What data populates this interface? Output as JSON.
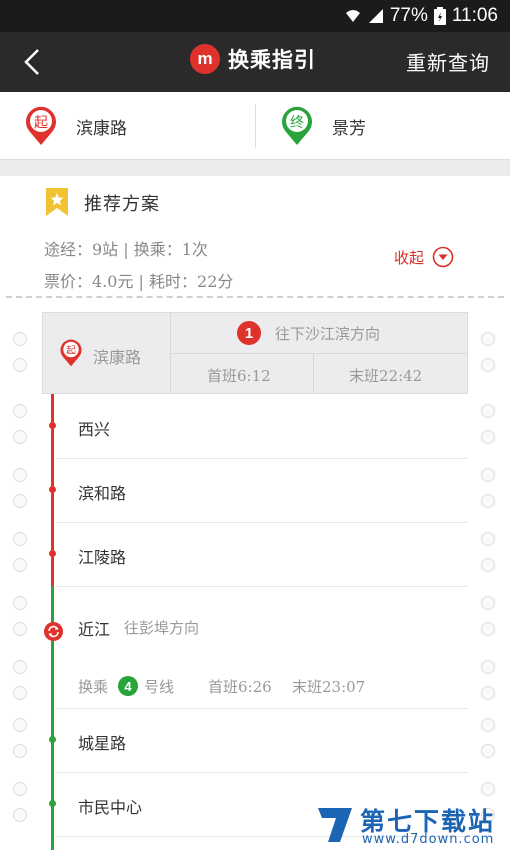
{
  "status_bar": {
    "battery": "77%",
    "time": "11:06"
  },
  "header": {
    "title": "换乘指引",
    "logo_letter": "m",
    "requery_label": "重新查询"
  },
  "route": {
    "origin_badge": "起",
    "origin": "滨康路",
    "destination_badge": "终",
    "destination": "景芳"
  },
  "plan": {
    "title": "推荐方案",
    "summary_line1": "途经：9站 | 换乘：1次",
    "summary_line2": "票价：4.0元 | 耗时：22分",
    "collapse_label": "收起"
  },
  "segment1": {
    "start_badge": "起",
    "start_station": "滨康路",
    "line_number": "1",
    "direction": "往下沙江滨方向",
    "first_train": "首班6:12",
    "last_train": "末班22:42"
  },
  "stations": [
    {
      "name": "西兴"
    },
    {
      "name": "滨和路"
    },
    {
      "name": "江陵路"
    },
    {
      "name": "近江",
      "direction": "往彭埠方向"
    },
    {
      "name": "城星路"
    },
    {
      "name": "市民中心"
    }
  ],
  "transfer": {
    "prefix": "换乘",
    "line_number": "4",
    "suffix": "号线",
    "first_train": "首班6:26",
    "last_train": "末班23:07"
  },
  "watermark": {
    "title": "第七下载站",
    "url": "www.d7down.com"
  },
  "colors": {
    "line1": "#e0322c",
    "line4": "#2aa33a",
    "accent": "#d9302a",
    "appbar": "#2a2a2a"
  }
}
